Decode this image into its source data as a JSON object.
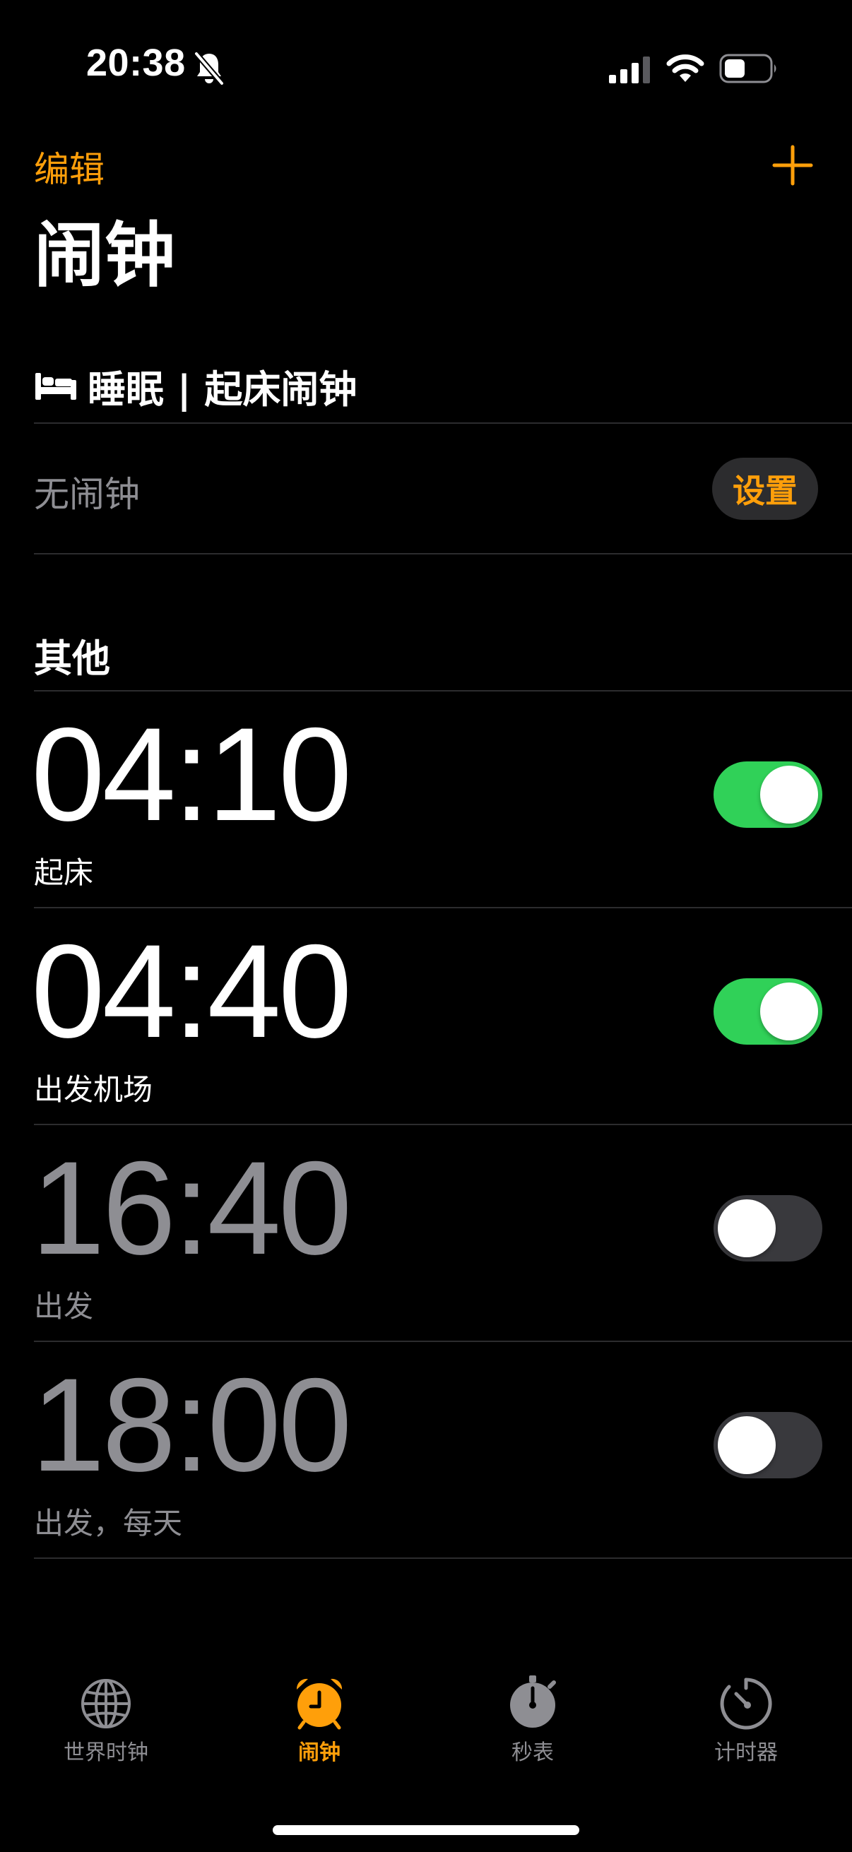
{
  "status_bar": {
    "time": "20:38"
  },
  "nav": {
    "edit_label": "编辑",
    "title": "闹钟"
  },
  "sleep": {
    "title": "睡眠 | 起床闹钟",
    "no_alarm": "无闹钟",
    "setup_label": "设置"
  },
  "others": {
    "title": "其他"
  },
  "alarms": [
    {
      "time": "04:10",
      "label": "起床",
      "enabled": true
    },
    {
      "time": "04:40",
      "label": "出发机场",
      "enabled": true
    },
    {
      "time": "16:40",
      "label": "出发",
      "enabled": false
    },
    {
      "time": "18:00",
      "label": "出发，每天",
      "enabled": false
    }
  ],
  "tabs": [
    {
      "label": "世界时钟",
      "icon": "globe-icon",
      "active": false
    },
    {
      "label": "闹钟",
      "icon": "alarm-clock-icon",
      "active": true
    },
    {
      "label": "秒表",
      "icon": "stopwatch-icon",
      "active": false
    },
    {
      "label": "计时器",
      "icon": "timer-icon",
      "active": false
    }
  ],
  "colors": {
    "accent": "#ff9f0a",
    "toggle_on": "#30d158",
    "toggle_off": "#39393d",
    "secondary_text": "#8e8e93",
    "background": "#000000"
  }
}
